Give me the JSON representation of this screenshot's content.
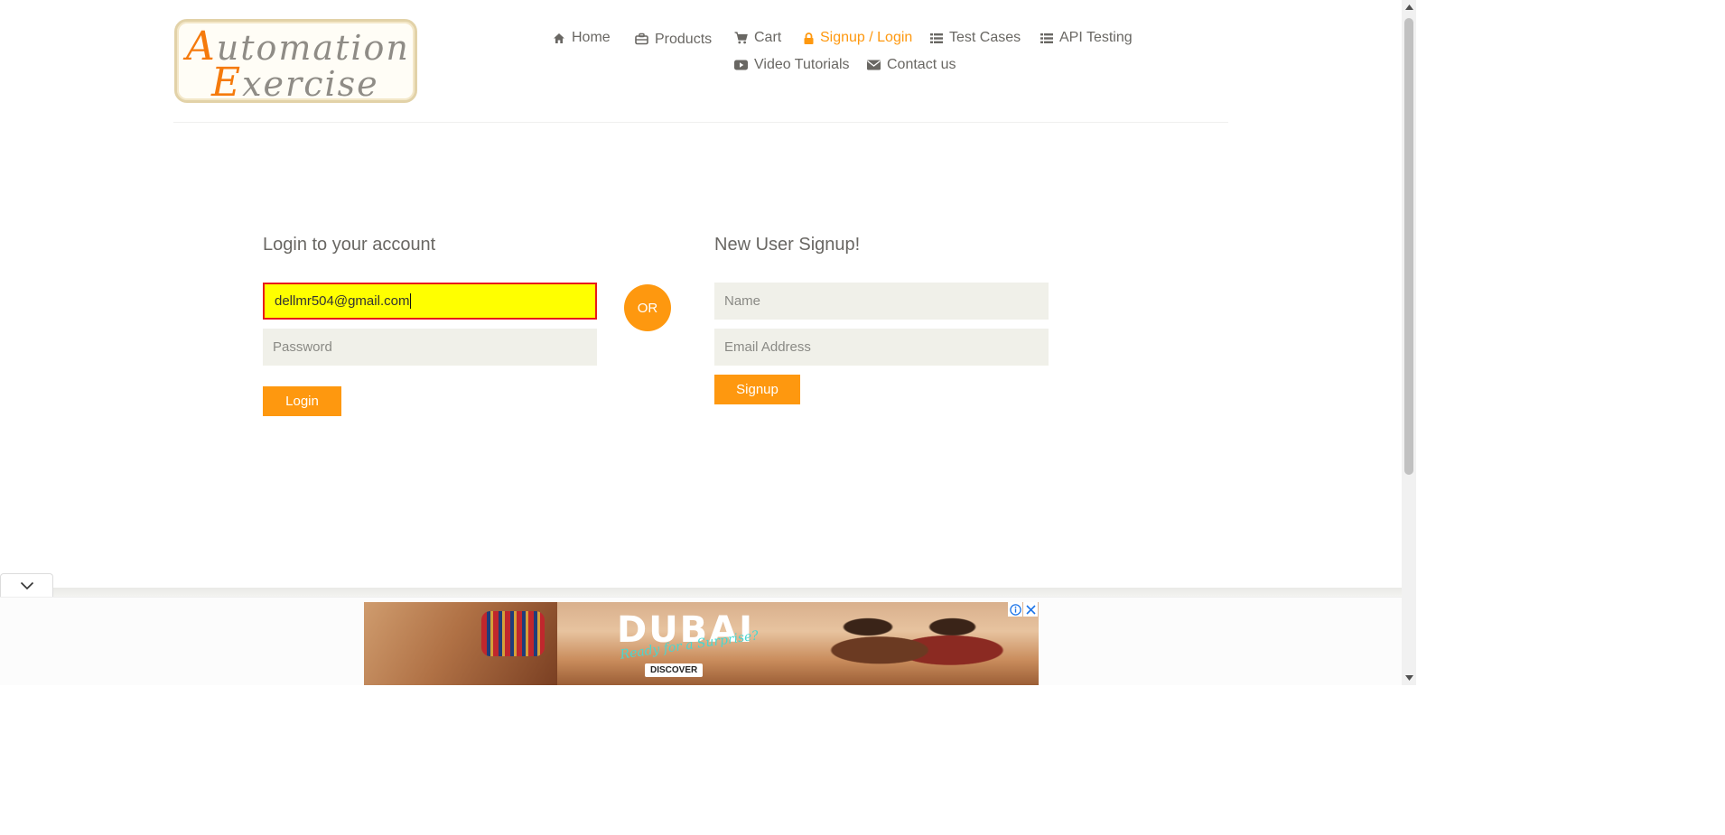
{
  "logo": {
    "line1_cap": "A",
    "line1_rest": "utomation",
    "line2_cap": "E",
    "line2_rest": "xercise"
  },
  "nav": {
    "home": "Home",
    "products": "Products",
    "cart": "Cart",
    "signup_login": "Signup / Login",
    "test_cases": "Test Cases",
    "api_testing": "API Testing",
    "video_tutorials": "Video Tutorials",
    "contact_us": "Contact us"
  },
  "login": {
    "title": "Login to your account",
    "email_value": "dellmr504@gmail.com",
    "password_placeholder": "Password",
    "button": "Login"
  },
  "or_label": "OR",
  "signup": {
    "title": "New User Signup!",
    "name_placeholder": "Name",
    "email_placeholder": "Email Address",
    "button": "Signup"
  },
  "ad": {
    "title": "DUBAI",
    "tagline": "Ready for a Surprise?",
    "cta": "DISCOVER"
  },
  "colors": {
    "accent": "#FE980F",
    "field_bg": "#F0F0E9",
    "highlight": "#FFFF00",
    "highlight_border": "#E81B1B"
  }
}
